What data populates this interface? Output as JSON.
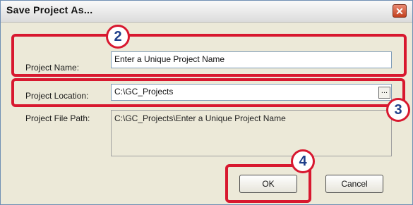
{
  "dialog": {
    "title": "Save Project As...",
    "close_glyph": "✕"
  },
  "fields": {
    "project_name_label": "Project Name:",
    "project_name_value": "Enter a Unique Project Name",
    "project_location_label": "Project Location:",
    "project_location_value": "C:\\GC_Projects",
    "browse_label": "...",
    "project_file_path_label": "Project File Path:",
    "project_file_path_value": "C:\\GC_Projects\\Enter a Unique Project Name"
  },
  "buttons": {
    "ok_label": "OK",
    "cancel_label": "Cancel"
  },
  "callouts": {
    "step_2": "2",
    "step_3": "3",
    "step_4": "4"
  },
  "colors": {
    "highlight": "#d8182f",
    "callout_number": "#1f3f8a"
  }
}
